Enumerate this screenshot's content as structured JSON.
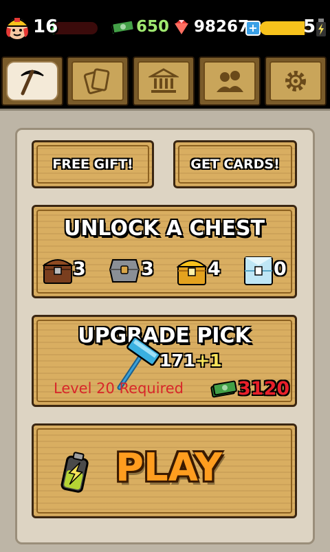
{
  "header": {
    "level": "16",
    "xp_progress": 0.08,
    "cash": "650",
    "gems": "98267",
    "energy": "5",
    "energy_progress": 0.9,
    "icons": [
      "player-avatar",
      "cash-icon",
      "gem-icon",
      "add-gems-icon",
      "battery-icon"
    ]
  },
  "tabs": [
    {
      "name": "mine",
      "icon": "pickaxe-icon",
      "active": true
    },
    {
      "name": "cards",
      "icon": "cards-icon",
      "active": false
    },
    {
      "name": "museum",
      "icon": "bank-icon",
      "active": false
    },
    {
      "name": "friends",
      "icon": "people-icon",
      "active": false
    },
    {
      "name": "settings",
      "icon": "gear-icon",
      "active": false
    }
  ],
  "buttons": {
    "free_gift": "FREE GIFT!",
    "get_cards": "GET CARDS!"
  },
  "chest": {
    "title": "UNLOCK A CHEST",
    "counts": [
      {
        "type": "wood",
        "count": "3"
      },
      {
        "type": "stone",
        "count": "3"
      },
      {
        "type": "gold",
        "count": "4"
      },
      {
        "type": "diamond",
        "count": "0"
      }
    ]
  },
  "upgrade": {
    "title": "UPGRADE PICK",
    "power": "171",
    "bonus": "+1",
    "requirement": "Level 20 Required",
    "cost": "3120"
  },
  "play": {
    "label": "PLAY"
  },
  "colors": {
    "wood": "#d9ae61",
    "cash_green": "#9fe870",
    "cost_red": "#e8202a",
    "play_orange": "#ff9d1f",
    "energy_yellow": "#f7c21c"
  }
}
